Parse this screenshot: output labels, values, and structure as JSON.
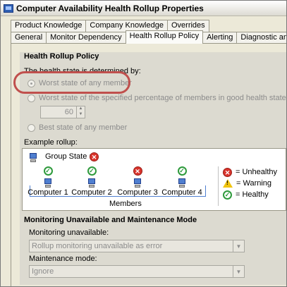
{
  "window": {
    "title": "Computer Availability Health Rollup Properties"
  },
  "tabs_top": [
    "Product Knowledge",
    "Company Knowledge",
    "Overrides"
  ],
  "tabs_bottom": [
    "General",
    "Monitor Dependency",
    "Health Rollup Policy",
    "Alerting",
    "Diagnostic and Recovery"
  ],
  "active_tab": "Health Rollup Policy",
  "policy": {
    "heading": "Health Rollup Policy",
    "determined_by_label": "The health state is determined by:",
    "options": [
      {
        "label": "Worst state of any member",
        "selected": true
      },
      {
        "label": "Worst state of the specified percentage of members in good health state:",
        "selected": false
      },
      {
        "label": "Best state of any member",
        "selected": false
      }
    ],
    "percentage_value": "60"
  },
  "example": {
    "label": "Example rollup:",
    "group_state_label": "Group State =",
    "group_state": "unhealthy",
    "members": [
      {
        "name": "Computer 1",
        "state": "healthy"
      },
      {
        "name": "Computer 2",
        "state": "healthy"
      },
      {
        "name": "Computer 3",
        "state": "unhealthy"
      },
      {
        "name": "Computer 4",
        "state": "healthy"
      }
    ],
    "members_label": "Members",
    "legend": [
      {
        "state": "unhealthy",
        "label": "= Unhealthy"
      },
      {
        "state": "warning",
        "label": "= Warning"
      },
      {
        "state": "healthy",
        "label": "= Healthy"
      }
    ]
  },
  "maintenance": {
    "heading": "Monitoring Unavailable and Maintenance Mode",
    "monitoring_label": "Monitoring unavailable:",
    "monitoring_value": "Rollup monitoring unavailable as error",
    "maintenance_label": "Maintenance mode:",
    "maintenance_value": "Ignore"
  },
  "icons": {
    "unhealthy_glyph": "✕",
    "healthy_glyph": "✓",
    "warning_glyph": "!",
    "spin_up_glyph": "▲",
    "spin_down_glyph": "▼",
    "combo_arrow_glyph": "▼"
  },
  "colors": {
    "unhealthy": "#d9342c",
    "healthy": "#2e9a3c",
    "warning": "#f1c40f",
    "highlight": "#c0504d"
  }
}
